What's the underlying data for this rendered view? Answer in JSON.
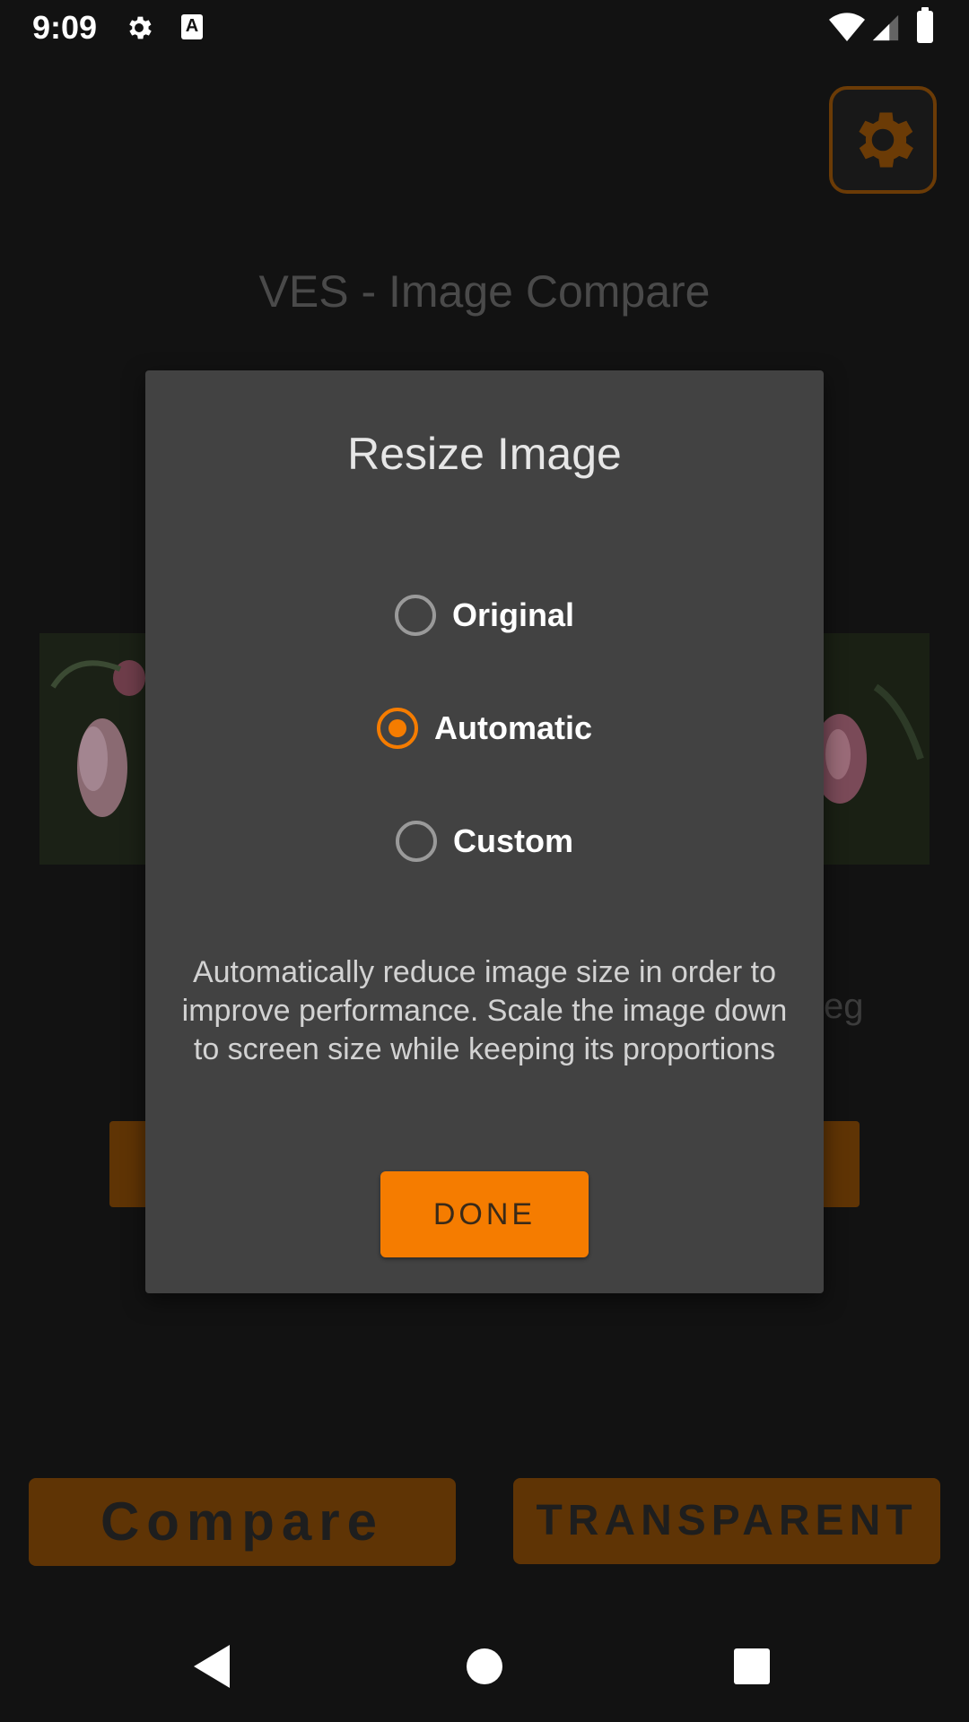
{
  "status_bar": {
    "time": "9:09",
    "icons": [
      "settings-icon",
      "a-icon",
      "wifi-icon",
      "signal-icon",
      "battery-icon"
    ]
  },
  "app": {
    "title": "VES - Image Compare",
    "compare_button": "Compare",
    "transparent_button": "TRANSPARENT",
    "file_fragment": "eg"
  },
  "dialog": {
    "title": "Resize Image",
    "options": [
      {
        "label": "Original",
        "selected": false
      },
      {
        "label": "Automatic",
        "selected": true
      },
      {
        "label": "Custom",
        "selected": false
      }
    ],
    "description": "Automatically reduce image size in order to improve performance. Scale the image down to screen size while keeping its proportions",
    "done_button": "DONE"
  },
  "colors": {
    "accent": "#f57c00",
    "dialog_bg": "#424242",
    "screen_bg": "#121212"
  }
}
